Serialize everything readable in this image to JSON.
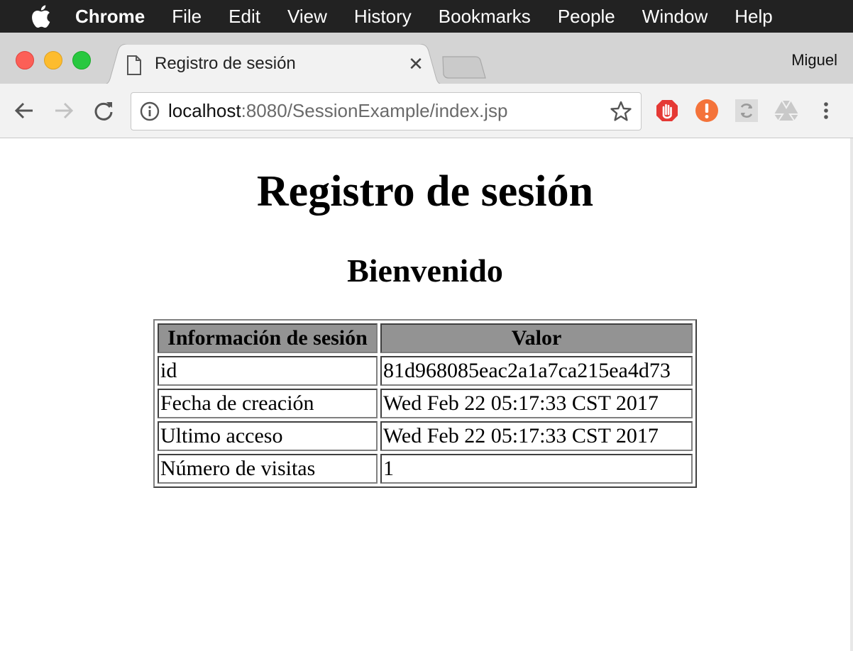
{
  "menubar": {
    "app": "Chrome",
    "items": [
      "File",
      "Edit",
      "View",
      "History",
      "Bookmarks",
      "People",
      "Window",
      "Help"
    ]
  },
  "tab": {
    "title": "Registro de sesión"
  },
  "profile": "Miguel",
  "omnibox": {
    "host": "localhost",
    "rest": ":8080/SessionExample/index.jsp"
  },
  "page": {
    "title": "Registro de sesión",
    "subtitle": "Bienvenido",
    "table": {
      "headers": [
        "Información de sesión",
        "Valor"
      ],
      "rows": [
        [
          "id",
          "81d968085eac2a1a7ca215ea4d73"
        ],
        [
          "Fecha de creación",
          "Wed Feb 22 05:17:33 CST 2017"
        ],
        [
          "Ultimo acceso",
          "Wed Feb 22 05:17:33 CST 2017"
        ],
        [
          "Número de visitas",
          "1"
        ]
      ]
    }
  },
  "icons": {
    "apple": "apple-logo-icon",
    "back": "back-arrow-icon",
    "forward": "forward-arrow-icon",
    "reload": "reload-icon",
    "info": "info-icon",
    "star": "star-icon",
    "ext1": "stop-hand-icon",
    "ext2": "alert-icon",
    "ext3": "sync-icon",
    "ext4": "drive-icon",
    "menu": "kebab-menu-icon"
  },
  "colors": {
    "menubar": "#222222",
    "header_cell": "#939393",
    "ext_red": "#e53935",
    "ext_orange": "#f4733a"
  }
}
